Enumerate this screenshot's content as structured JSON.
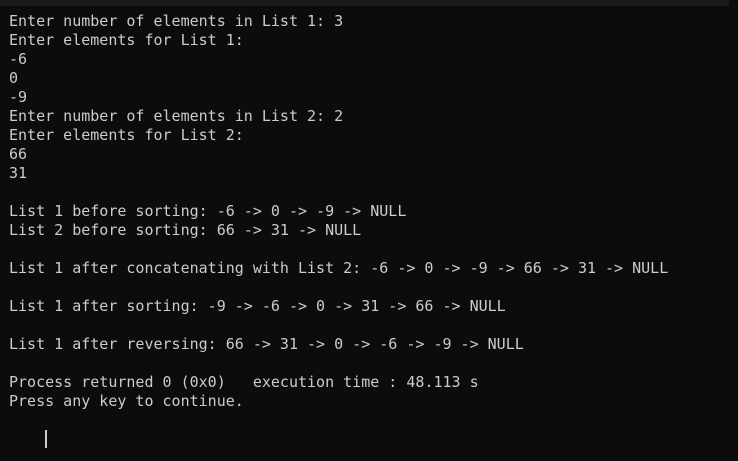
{
  "console": {
    "lines": [
      "Enter number of elements in List 1: 3",
      "Enter elements for List 1:",
      "-6",
      "0",
      "-9",
      "Enter number of elements in List 2: 2",
      "Enter elements for List 2:",
      "66",
      "31",
      "",
      "List 1 before sorting: -6 -> 0 -> -9 -> NULL",
      "List 2 before sorting: 66 -> 31 -> NULL",
      "",
      "List 1 after concatenating with List 2: -6 -> 0 -> -9 -> 66 -> 31 -> NULL",
      "",
      "List 1 after sorting: -9 -> -6 -> 0 -> 31 -> 66 -> NULL",
      "",
      "List 1 after reversing: 66 -> 31 -> 0 -> -6 -> -9 -> NULL",
      "",
      "Process returned 0 (0x0)   execution time : 48.113 s",
      "Press any key to continue."
    ]
  }
}
